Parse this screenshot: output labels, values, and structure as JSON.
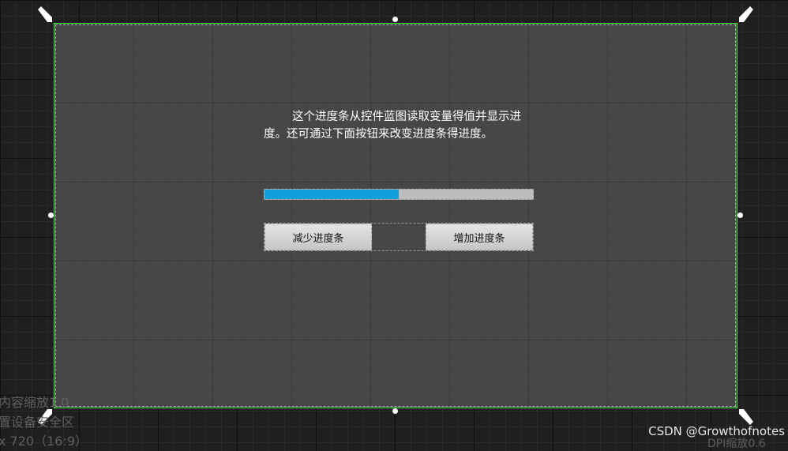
{
  "widget": {
    "description": "这个进度条从控件蓝图读取变量得值并显示进度。还可通过下面按钮来改变进度条得进度。"
  },
  "progress_bar": {
    "percent": 50,
    "fill_color": "#12a0dc",
    "track_color": "#bdbdbd"
  },
  "buttons": {
    "decrease_label": "减少进度条",
    "increase_label": "增加进度条"
  },
  "designer_info": {
    "content_scale": "内容缩放1.0",
    "device_safe_zone": "置设备安全区",
    "resolution": "x 720（16:9）",
    "dpi_scale": "DPI缩放0.6"
  },
  "watermark": "CSDN @Growthofnotes",
  "colors": {
    "safe_zone_border": "#3cff3c",
    "canvas_background": "#474747"
  }
}
